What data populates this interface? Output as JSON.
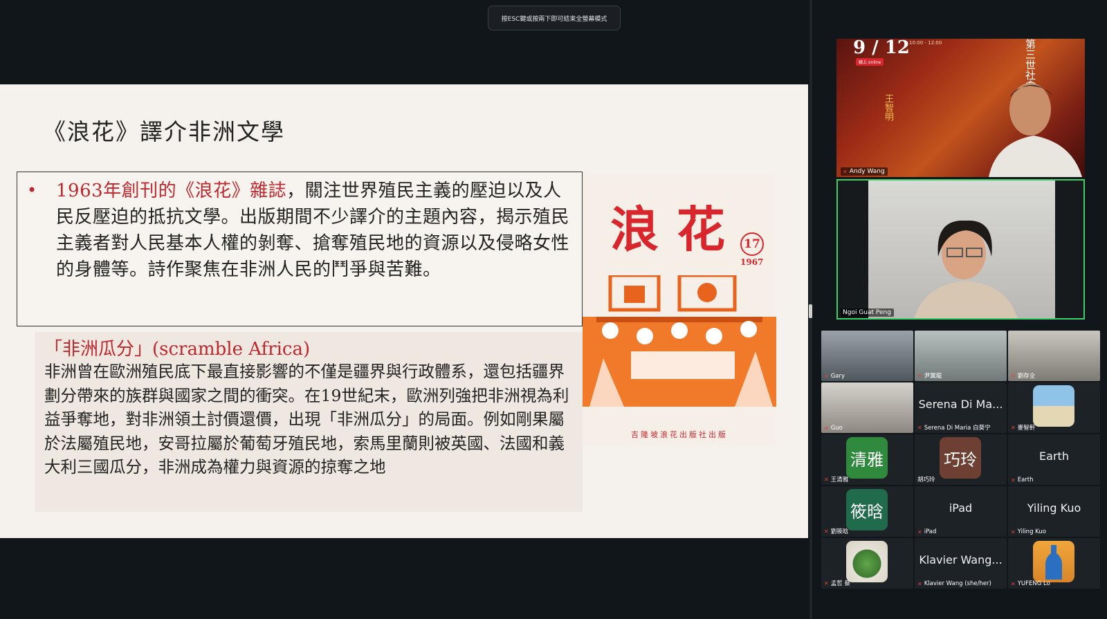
{
  "fullscreen_hint": "按ESC鍵或按兩下即可結束全螢幕模式",
  "slide": {
    "title": "《浪花》譯介非洲文學",
    "bullet": "•",
    "para1_red": "1963年創刊的《浪花》雜誌",
    "para1_rest": "，關注世界殖民主義的壓迫以及人民反壓迫的抵抗文學。出版期間不少譯介的主題內容，揭示殖民主義者對人民基本人權的剝奪、搶奪殖民地的資源以及侵略女性的身體等。詩作聚焦在非洲人民的鬥爭與苦難。",
    "subtitle": "「非洲瓜分」(scramble Africa)",
    "para2": "非洲曾在歐洲殖民底下最直接影響的不僅是疆界與行政體系，還包括疆界劃分帶來的族群與國家之間的衝突。在19世紀末，歐洲列強把非洲視為利益爭奪地，對非洲領土討價還價，出現「非洲瓜分」的局面。例如剛果屬於法屬殖民地，安哥拉屬於葡萄牙殖民地，索馬里蘭則被英國、法國和義大利三國瓜分，非洲成為權力與資源的掠奪之地",
    "cover": {
      "title": "浪花",
      "issue": "17",
      "year": "1967",
      "publisher": "吉隆坡浪花出版社出版"
    }
  },
  "participants": {
    "speaker1": {
      "name": "Andy Wang",
      "poster_date": "9 / 12",
      "poster_time": "10:00 - 12:00",
      "poster_online": "線上 online",
      "poster_host": "王智明",
      "poster_series": "第三世社會"
    },
    "speaker2": {
      "name": "Ngoi Guat Peng"
    },
    "gallery": [
      {
        "name": "Gary",
        "type": "video"
      },
      {
        "name": "尹翼龍",
        "type": "video"
      },
      {
        "name": "劉存全",
        "type": "video"
      },
      {
        "name": "Guo",
        "type": "video"
      },
      {
        "name": "Serena Di Maria 白葵宁",
        "display": "Serena Di Ma...",
        "type": "text"
      },
      {
        "name": "麥智軒",
        "type": "photo"
      },
      {
        "name": "王清雅",
        "avatar_text": "清雅",
        "avatar_color": "#2f8a3e",
        "type": "avatar"
      },
      {
        "name": "胡巧玲",
        "avatar_text": "巧玲",
        "avatar_color": "#6d4033",
        "type": "avatar"
      },
      {
        "name": "Earth",
        "display": "Earth",
        "type": "text"
      },
      {
        "name": "劉筱晗",
        "avatar_text": "筱晗",
        "avatar_color": "#1f6b4c",
        "type": "avatar"
      },
      {
        "name": "iPad",
        "display": "iPad",
        "type": "text"
      },
      {
        "name": "Yiling Kuo",
        "display": "Yiling Kuo",
        "type": "text"
      },
      {
        "name": "孟哲 蔡",
        "type": "photo"
      },
      {
        "name": "Klavier Wang (she/her)",
        "display": "Klavier Wang...",
        "type": "text"
      },
      {
        "name": "YUFENG Lo",
        "type": "photo"
      }
    ]
  }
}
